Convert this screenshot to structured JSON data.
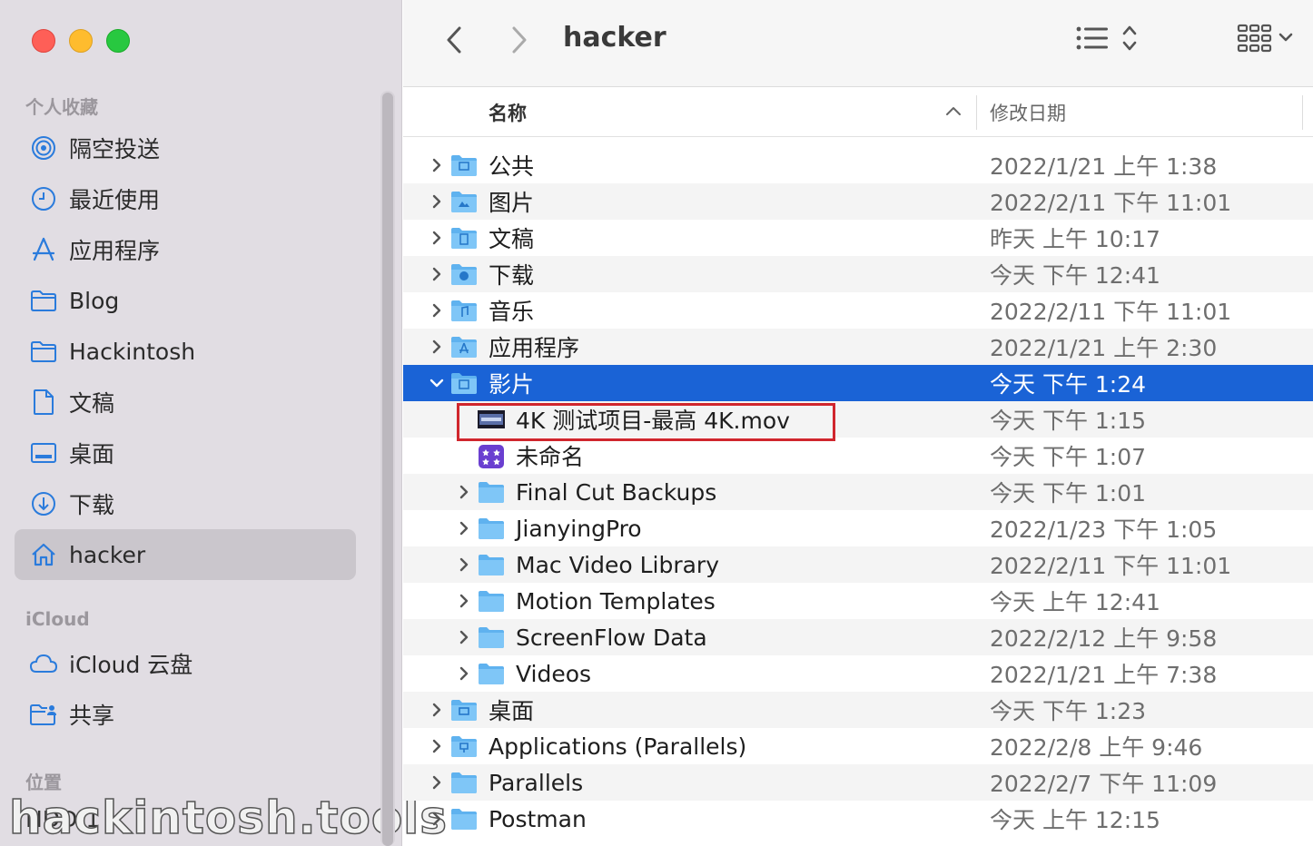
{
  "window": {
    "title": "hacker"
  },
  "sidebar": {
    "favorites_header": "个人收藏",
    "favorites": [
      {
        "label": "隔空投送",
        "icon": "airdrop-icon"
      },
      {
        "label": "最近使用",
        "icon": "clock-icon"
      },
      {
        "label": "应用程序",
        "icon": "applications-icon"
      },
      {
        "label": "Blog",
        "icon": "folder-icon"
      },
      {
        "label": "Hackintosh",
        "icon": "folder-icon"
      },
      {
        "label": "文稿",
        "icon": "document-icon"
      },
      {
        "label": "桌面",
        "icon": "desktop-icon"
      },
      {
        "label": "下载",
        "icon": "download-icon"
      },
      {
        "label": "hacker",
        "icon": "home-icon",
        "active": true
      }
    ],
    "icloud_header": "iCloud",
    "icloud": [
      {
        "label": "iCloud 云盘",
        "icon": "cloud-icon"
      },
      {
        "label": "共享",
        "icon": "shared-folder-icon"
      }
    ],
    "locations_header": "位置",
    "locations": [
      {
        "label": "HDD-1",
        "icon": "disk-icon"
      }
    ],
    "watermark": "hackintosh.tools"
  },
  "columns": {
    "name": "名称",
    "date": "修改日期"
  },
  "files": [
    {
      "name": "公共",
      "date": "2022/1/21 上午 1:38",
      "level": 0,
      "kind": "folder-public"
    },
    {
      "name": "图片",
      "date": "2022/2/11 下午 11:01",
      "level": 0,
      "kind": "folder-pictures"
    },
    {
      "name": "文稿",
      "date": "昨天 上午 10:17",
      "level": 0,
      "kind": "folder-documents"
    },
    {
      "name": "下载",
      "date": "今天 下午 12:41",
      "level": 0,
      "kind": "folder-downloads"
    },
    {
      "name": "音乐",
      "date": "2022/2/11 下午 11:01",
      "level": 0,
      "kind": "folder-music"
    },
    {
      "name": "应用程序",
      "date": "2022/1/21 上午 2:30",
      "level": 0,
      "kind": "folder-apps"
    },
    {
      "name": "影片",
      "date": "今天 下午 1:24",
      "level": 0,
      "kind": "folder-movies",
      "expanded": true,
      "selected": true
    },
    {
      "name": "4K 测试项目-最高 4K.mov",
      "date": "今天 下午 1:15",
      "level": 1,
      "kind": "video-file"
    },
    {
      "name": "未命名",
      "date": "今天 下午 1:07",
      "level": 1,
      "kind": "fcp-library"
    },
    {
      "name": "Final Cut Backups",
      "date": "今天 下午 1:01",
      "level": 1,
      "kind": "folder"
    },
    {
      "name": "JianyingPro",
      "date": "2022/1/23 下午 1:05",
      "level": 1,
      "kind": "folder"
    },
    {
      "name": "Mac Video Library",
      "date": "2022/2/11 下午 11:01",
      "level": 1,
      "kind": "folder"
    },
    {
      "name": "Motion Templates",
      "date": "今天 上午 12:41",
      "level": 1,
      "kind": "folder"
    },
    {
      "name": "ScreenFlow Data",
      "date": "2022/2/12 上午 9:58",
      "level": 1,
      "kind": "folder"
    },
    {
      "name": "Videos",
      "date": "2022/1/21 上午 7:38",
      "level": 1,
      "kind": "folder"
    },
    {
      "name": "桌面",
      "date": "今天 下午 1:23",
      "level": 0,
      "kind": "folder-desktop"
    },
    {
      "name": "Applications (Parallels)",
      "date": "2022/2/8 上午 9:46",
      "level": 0,
      "kind": "folder-parallels"
    },
    {
      "name": "Parallels",
      "date": "2022/2/7 下午 11:09",
      "level": 0,
      "kind": "folder"
    },
    {
      "name": "Postman",
      "date": "今天 上午 12:15",
      "level": 0,
      "kind": "folder"
    }
  ]
}
